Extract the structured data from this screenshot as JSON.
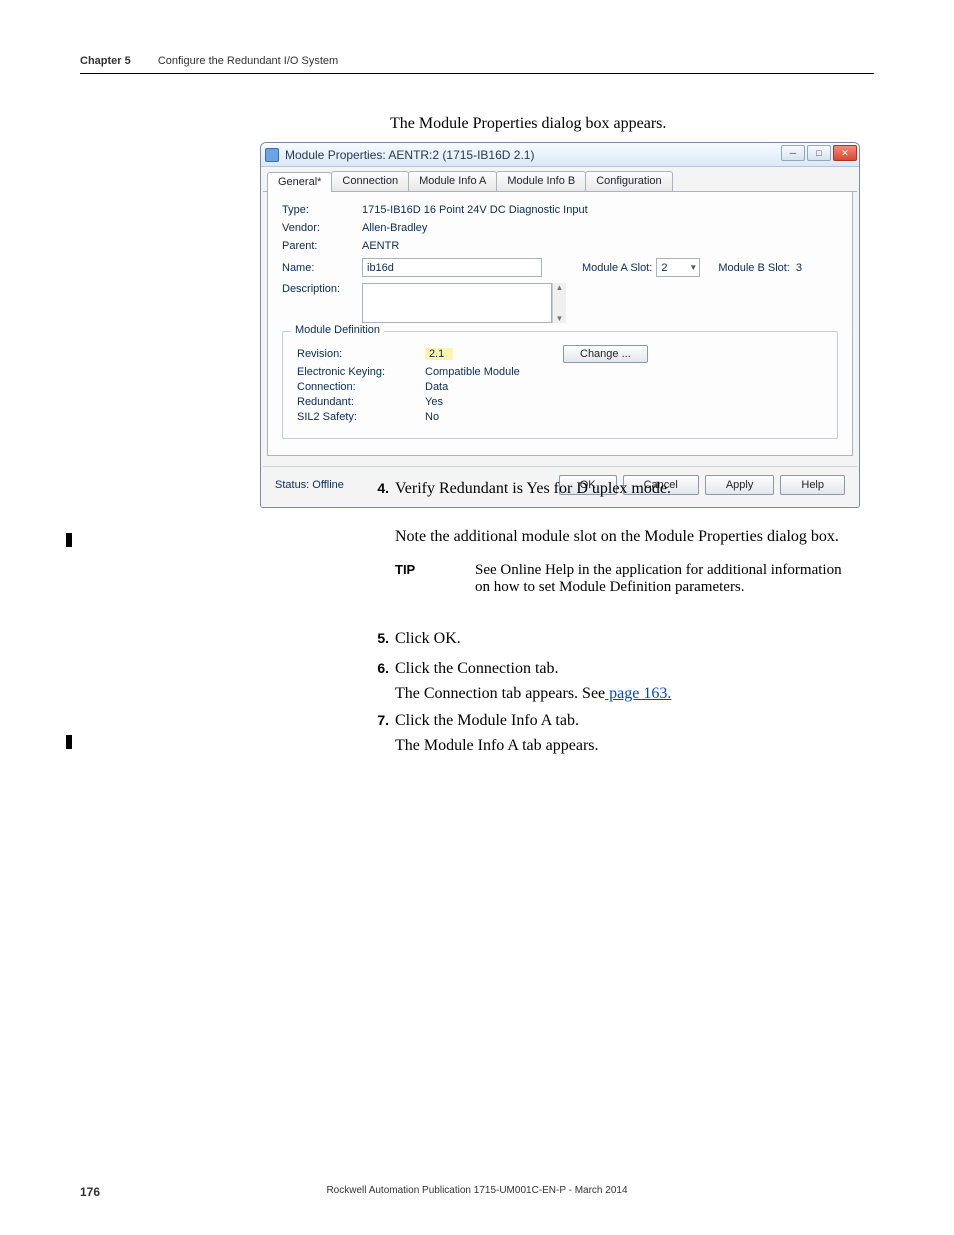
{
  "header": {
    "chapter": "Chapter 5",
    "title": "Configure the Redundant I/O System"
  },
  "caption_top": "The Module Properties dialog box appears.",
  "dialog": {
    "title": "Module Properties: AENTR:2 (1715-IB16D 2.1)",
    "tabs": [
      "General*",
      "Connection",
      "Module Info A",
      "Module Info B",
      "Configuration"
    ],
    "labels": {
      "type": "Type:",
      "vendor": "Vendor:",
      "parent": "Parent:",
      "name": "Name:",
      "description": "Description:",
      "module_a_slot": "Module A Slot:",
      "module_b_slot": "Module B Slot:"
    },
    "values": {
      "type": "1715-IB16D 16 Point 24V DC Diagnostic Input",
      "vendor": "Allen-Bradley",
      "parent": "AENTR",
      "name": "ib16d",
      "description": "",
      "module_a_slot": "2",
      "module_b_slot": "3"
    },
    "mod_def": {
      "legend": "Module Definition",
      "revision_lbl": "Revision:",
      "revision_val": "2.1",
      "keying_lbl": "Electronic Keying:",
      "keying_val": "Compatible Module",
      "conn_lbl": "Connection:",
      "conn_val": "Data",
      "redund_lbl": "Redundant:",
      "redund_val": "Yes",
      "sil_lbl": "SIL2 Safety:",
      "sil_val": "No",
      "change_btn": "Change ..."
    },
    "status": "Status: Offline",
    "buttons": {
      "ok": "OK",
      "cancel": "Cancel",
      "apply": "Apply",
      "help": "Help"
    },
    "winicons": {
      "min": "─",
      "max": "□",
      "close": "✕"
    }
  },
  "steps": {
    "s4": {
      "num": "4.",
      "txt": "Verify Redundant is Yes for D uplex mode."
    },
    "s5": {
      "num": "5.",
      "txt": "Click OK."
    },
    "s6": {
      "num": "6.",
      "txt": "Click the Connection tab."
    },
    "s7": {
      "num": "7.",
      "txt": "Click the Module Info A tab."
    }
  },
  "paras": {
    "note_additional": "Note the additional module slot on the Module Properties dialog box.",
    "conn_tab_appears_pre": "The Connection tab appears. See",
    "conn_tab_link": " page 163.",
    "infoA_appears": "The Module Info A tab appears."
  },
  "tip": {
    "label": "TIP",
    "text": "See Online Help in the application for additional information on how to set Module Definition parameters."
  },
  "footer": {
    "page": "176",
    "pub": "Rockwell Automation Publication 1715-UM001C-EN-P - March 2014"
  }
}
